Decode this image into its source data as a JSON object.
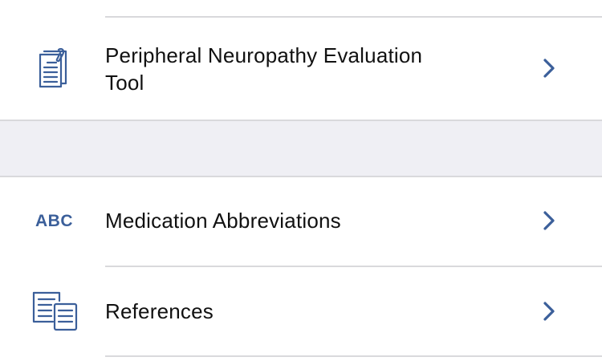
{
  "accent_color": "#3b5f9a",
  "rows": [
    {
      "label_line1": "Peripheral Neuropathy Evaluation",
      "label_line2": "Tool",
      "icon": "clipboard-document-icon",
      "chevron": "chevron-right-icon"
    },
    {
      "label": "Medication Abbreviations",
      "icon_text": "ABC",
      "icon": "abc-text-icon",
      "chevron": "chevron-right-icon"
    },
    {
      "label": "References",
      "icon": "documents-icon",
      "chevron": "chevron-right-icon"
    }
  ]
}
